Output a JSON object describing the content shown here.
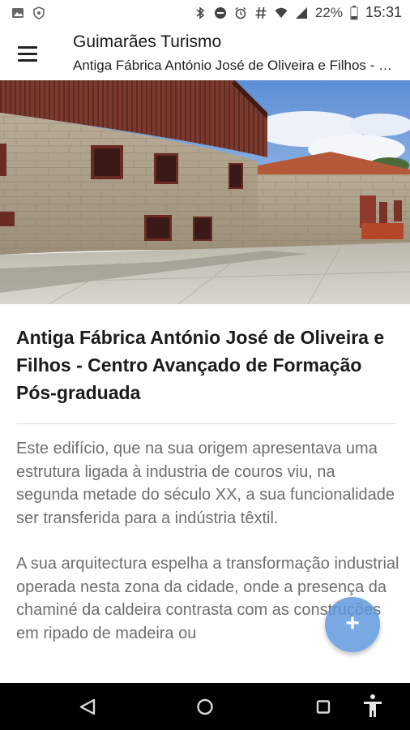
{
  "status_bar": {
    "battery_percent": "22%",
    "time": "15:31",
    "icons": [
      "image-icon",
      "shield-icon",
      "bluetooth-icon",
      "do-not-disturb-icon",
      "alarm-icon",
      "hash-icon",
      "wifi-icon",
      "signal-icon",
      "battery-icon"
    ]
  },
  "app_bar": {
    "title": "Guimarães Turismo",
    "subtitle": "Antiga Fábrica António José de Oliveira e Filhos - Centro Avançado de Formação Pós-graduada"
  },
  "place": {
    "title": "Antiga Fábrica António José de Oliveira e Filhos - Centro Avançado de Formação Pós-graduada",
    "description": [
      "Este edifício, que na sua origem apresentava uma estrutura ligada à industria de couros viu, na segunda metade do século XX, a sua funcionalidade ser transferida para a indústria têxtil.",
      "A sua arquitectura espelha a transformação industrial operada nesta zona da cidade, onde a presença da chaminé da caldeira contrasta com as construções em ripado de madeira ou"
    ]
  },
  "fab": {
    "label": "+"
  },
  "nav_bar": {
    "icons": [
      "back-icon",
      "home-icon",
      "recents-icon",
      "accessibility-icon"
    ]
  },
  "colors": {
    "fab": "#5a96dc",
    "nav_bar": "#000000",
    "title_text": "#1b1b1b",
    "body_text": "#6e6e6e"
  }
}
